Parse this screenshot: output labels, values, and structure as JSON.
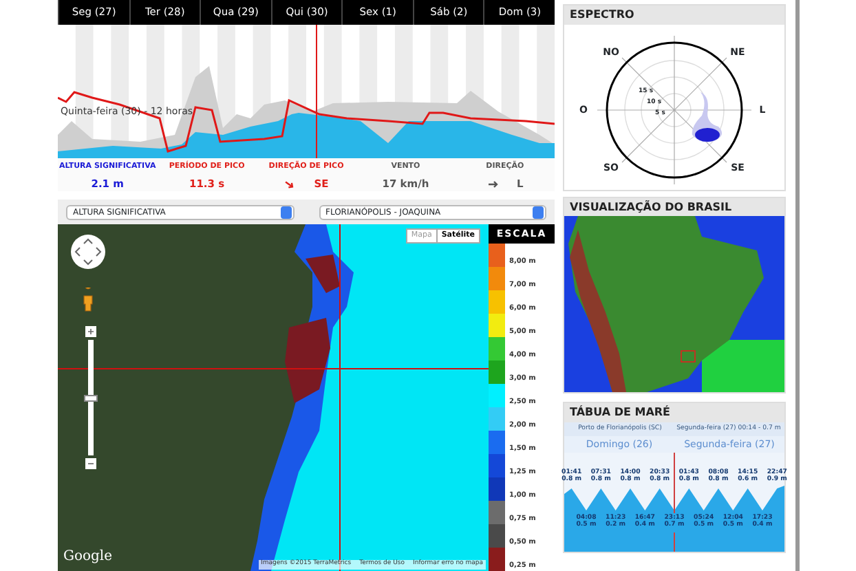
{
  "forecast": {
    "days": [
      {
        "label": "Seg (27)"
      },
      {
        "label": "Ter (28)"
      },
      {
        "label": "Qua (29)"
      },
      {
        "label": "Qui (30)"
      },
      {
        "label": "Sex (1)"
      },
      {
        "label": "Sáb (2)"
      },
      {
        "label": "Dom (3)"
      }
    ],
    "cursor_label": "Quinta-feira (30) - 12 horas",
    "stats": [
      {
        "label": "ALTURA SIGNIFICATIVA",
        "value": "2.1 m",
        "color": "#1a1ad6",
        "kind": "value"
      },
      {
        "label": "PERÍODO DE PICO",
        "value": "11.3 s",
        "color": "#e0201a",
        "kind": "value"
      },
      {
        "label": "DIREÇÃO DE PICO",
        "value": "SE",
        "color": "#e0201a",
        "kind": "direction"
      },
      {
        "label": "VENTO",
        "value": "17 km/h",
        "color": "#555555",
        "kind": "value"
      },
      {
        "label": "DIREÇÃO",
        "value": "L",
        "color": "#555555",
        "kind": "direction"
      }
    ]
  },
  "selects": [
    {
      "value": "ALTURA SIGNIFICATIVA"
    },
    {
      "value": "FLORIANÓPOLIS - JOAQUINA"
    }
  ],
  "map": {
    "types": [
      {
        "label": "Mapa",
        "selected": false
      },
      {
        "label": "Satélite",
        "selected": true
      }
    ],
    "zoom": {
      "level": 0.5
    },
    "logo": "Google",
    "attribution": [
      "Imagens ©2015 TerraMetrics",
      "Termos de Uso",
      "Informar erro no mapa"
    ],
    "scale": {
      "title": "ESCALA",
      "items": [
        {
          "label": "8,00 m",
          "color": "#e8601c"
        },
        {
          "label": "7,00 m",
          "color": "#f28a0c"
        },
        {
          "label": "6,00 m",
          "color": "#f7c100"
        },
        {
          "label": "5,00 m",
          "color": "#f2ec10"
        },
        {
          "label": "4,00 m",
          "color": "#34c934"
        },
        {
          "label": "3,00 m",
          "color": "#1ea51e"
        },
        {
          "label": "2,50 m",
          "color": "#00f0ff"
        },
        {
          "label": "2,00 m",
          "color": "#33ccf5"
        },
        {
          "label": "1,50 m",
          "color": "#1a6cf0"
        },
        {
          "label": "1,25 m",
          "color": "#1448d8"
        },
        {
          "label": "1,00 m",
          "color": "#1038b8"
        },
        {
          "label": "0,75 m",
          "color": "#6c6c6c"
        },
        {
          "label": "0,50 m",
          "color": "#4a4a4a"
        },
        {
          "label": "0,25 m",
          "color": "#8a1c1c"
        }
      ]
    }
  },
  "spectrum": {
    "title": "ESPECTRO",
    "directions": [
      "NO",
      "NE",
      "O",
      "L",
      "SO",
      "SE"
    ],
    "rings": [
      "15 s",
      "10 s",
      "5 s"
    ]
  },
  "brazil": {
    "title": "VISUALIZAÇÃO DO BRASIL"
  },
  "tide": {
    "title": "TÁBUA DE MARÉ",
    "station": "Porto de Florianópolis (SC)",
    "current": "Segunda-feira (27) 00:14 - 0.7 m",
    "days": [
      "Domingo (26)",
      "Segunda-feira (27)"
    ],
    "events": [
      {
        "time": "01:41",
        "height": "0.8 m",
        "kind": "high"
      },
      {
        "time": "04:08",
        "height": "0.5 m",
        "kind": "low"
      },
      {
        "time": "07:31",
        "height": "0.8 m",
        "kind": "high"
      },
      {
        "time": "11:23",
        "height": "0.2 m",
        "kind": "low"
      },
      {
        "time": "14:00",
        "height": "0.8 m",
        "kind": "high"
      },
      {
        "time": "16:47",
        "height": "0.4 m",
        "kind": "low"
      },
      {
        "time": "20:33",
        "height": "0.8 m",
        "kind": "high"
      },
      {
        "time": "23:13",
        "height": "0.7 m",
        "kind": "low"
      },
      {
        "time": "01:43",
        "height": "0.8 m",
        "kind": "high"
      },
      {
        "time": "05:24",
        "height": "0.5 m",
        "kind": "low"
      },
      {
        "time": "08:08",
        "height": "0.8 m",
        "kind": "high"
      },
      {
        "time": "12:04",
        "height": "0.5 m",
        "kind": "low"
      },
      {
        "time": "14:15",
        "height": "0.6 m",
        "kind": "high"
      },
      {
        "time": "17:23",
        "height": "0.4 m",
        "kind": "low"
      },
      {
        "time": "22:47",
        "height": "0.9 m",
        "kind": "high"
      }
    ]
  }
}
